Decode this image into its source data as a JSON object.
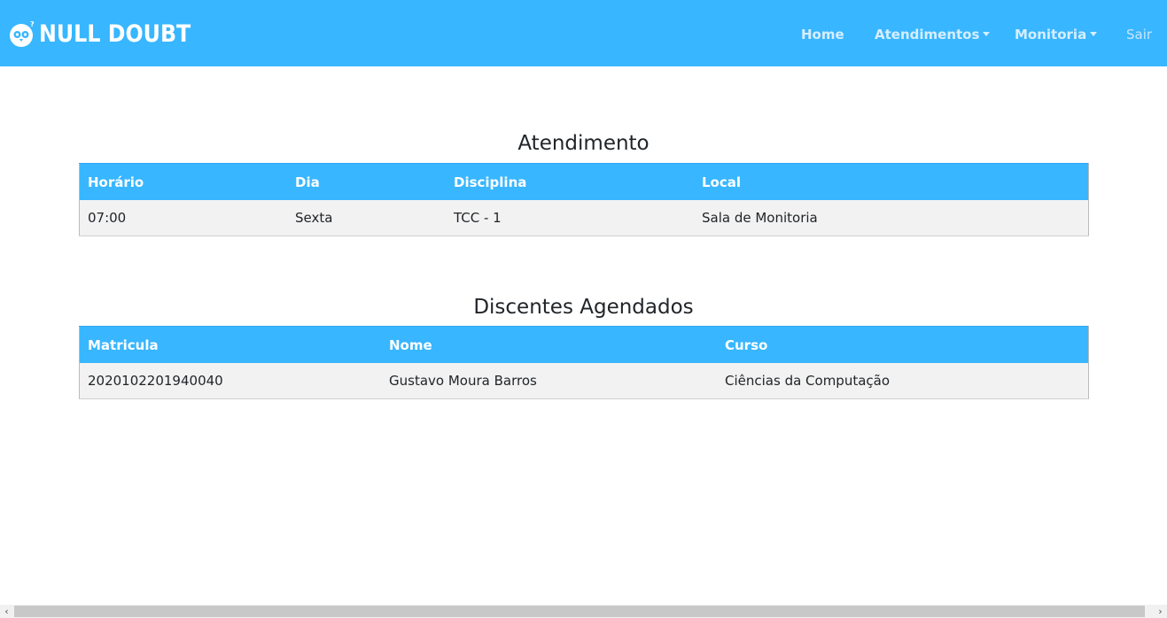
{
  "navbar": {
    "brand": "NULL DOUBT",
    "items": [
      {
        "label": "Home",
        "dropdown": false
      },
      {
        "label": "Atendimentos",
        "dropdown": true
      },
      {
        "label": "Monitoria",
        "dropdown": true
      },
      {
        "label": "Sair",
        "dropdown": false
      }
    ],
    "color": "#38b6ff"
  },
  "atendimento": {
    "title": "Atendimento",
    "columns": [
      "Horário",
      "Dia",
      "Disciplina",
      "Local"
    ],
    "rows": [
      [
        "07:00",
        "Sexta",
        "TCC - 1",
        "Sala de Monitoria"
      ]
    ]
  },
  "discentes": {
    "title": "Discentes Agendados",
    "columns": [
      "Matricula",
      "Nome",
      "Curso"
    ],
    "rows": [
      [
        "2020102201940040",
        "Gustavo Moura Barros",
        "Ciências da Computação"
      ]
    ]
  },
  "scrollbar": {
    "left_arrow": "‹",
    "right_arrow": "›"
  }
}
